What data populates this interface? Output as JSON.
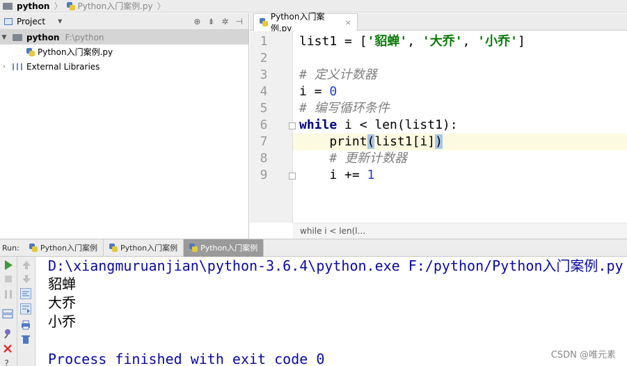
{
  "breadcrumb": {
    "project": "python",
    "file": "Python入门案例.py"
  },
  "project_panel": {
    "title": "Project",
    "root_name": "python",
    "root_path": "F:\\python",
    "file_name": "Python入门案例.py",
    "external_libraries": "External Libraries"
  },
  "editor": {
    "tab_label": "Python入门案例.py",
    "line_numbers": [
      "1",
      "2",
      "3",
      "4",
      "5",
      "6",
      "7",
      "8",
      "9"
    ],
    "lines": {
      "l1_a": "list1 = [",
      "l1_s1": "'貂蝉'",
      "l1_c1": ", ",
      "l1_s2": "'大乔'",
      "l1_c2": ", ",
      "l1_s3": "'小乔'",
      "l1_end": "]",
      "l3": "# 定义计数器",
      "l4_a": "i = ",
      "l4_n": "0",
      "l5": "# 编写循环条件",
      "l6_kw": "while",
      "l6_rest": " i < len(list1):",
      "l7_a": "    print",
      "l7_b1": "(",
      "l7_mid": "list1[i]",
      "l7_b2": ")",
      "l8": "    # 更新计数器",
      "l9_a": "    i += ",
      "l9_n": "1"
    },
    "status_crumb": "while i < len(l..."
  },
  "run_panel": {
    "label": "Run:",
    "tabs": [
      "Python入门案例",
      "Python入门案例",
      "Python入门案例"
    ]
  },
  "console": {
    "command": "D:\\xiangmuruanjian\\python-3.6.4\\python.exe F:/python/Python入门案例.py",
    "outputs": [
      "貂蝉",
      "大乔",
      "小乔"
    ],
    "exit_message": "Process finished with exit code 0"
  },
  "watermark": "CSDN @唯元素"
}
